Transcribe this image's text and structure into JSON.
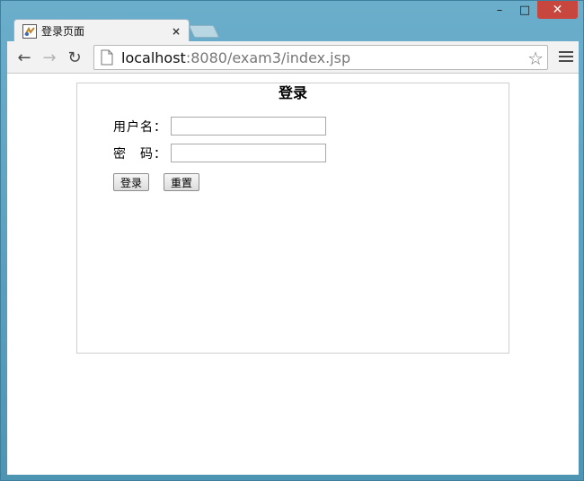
{
  "window": {
    "minimize_glyph": "–",
    "maximize_glyph": "□",
    "close_glyph": "✕"
  },
  "tab": {
    "title": "登录页面",
    "close_glyph": "×",
    "favicon": "jsp-favicon-icon"
  },
  "toolbar": {
    "back_glyph": "←",
    "forward_glyph": "→",
    "reload_glyph": "↻",
    "url_host": "localhost",
    "url_rest": ":8080/exam3/index.jsp",
    "star_glyph": "☆"
  },
  "login": {
    "title": "登录",
    "username_label": "用户名：",
    "username_value": "",
    "password_label": "密　码：",
    "password_value": "",
    "submit_label": "登录",
    "reset_label": "重置"
  },
  "colors": {
    "frame": "#5a9fbd",
    "close_button": "#c7463d",
    "tab_bg": "#f2f2f2"
  }
}
